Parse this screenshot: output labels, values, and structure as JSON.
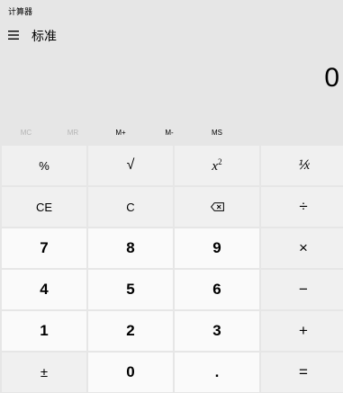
{
  "window": {
    "title": "计算器"
  },
  "header": {
    "menu_icon": "hamburger-menu-icon",
    "mode": "标准"
  },
  "display": {
    "value": "0"
  },
  "memory": [
    {
      "label": "MC",
      "enabled": false
    },
    {
      "label": "MR",
      "enabled": false
    },
    {
      "label": "M+",
      "enabled": true
    },
    {
      "label": "M-",
      "enabled": true
    },
    {
      "label": "MS",
      "enabled": true
    }
  ],
  "keys": {
    "percent": "%",
    "sqrt": "√",
    "square_base": "x",
    "square_exp": "2",
    "reciprocal": "⅟x",
    "ce": "CE",
    "c": "C",
    "backspace_icon": "backspace-icon",
    "divide": "÷",
    "seven": "7",
    "eight": "8",
    "nine": "9",
    "multiply": "×",
    "four": "4",
    "five": "5",
    "six": "6",
    "minus": "−",
    "one": "1",
    "two": "2",
    "three": "3",
    "plus": "+",
    "negate": "±",
    "zero": "0",
    "decimal": ".",
    "equals": "="
  },
  "colors": {
    "background": "#e6e6e6",
    "function_key": "#f0f0f0",
    "number_key": "#fafafa",
    "memory_disabled": "#b5b5b5"
  }
}
